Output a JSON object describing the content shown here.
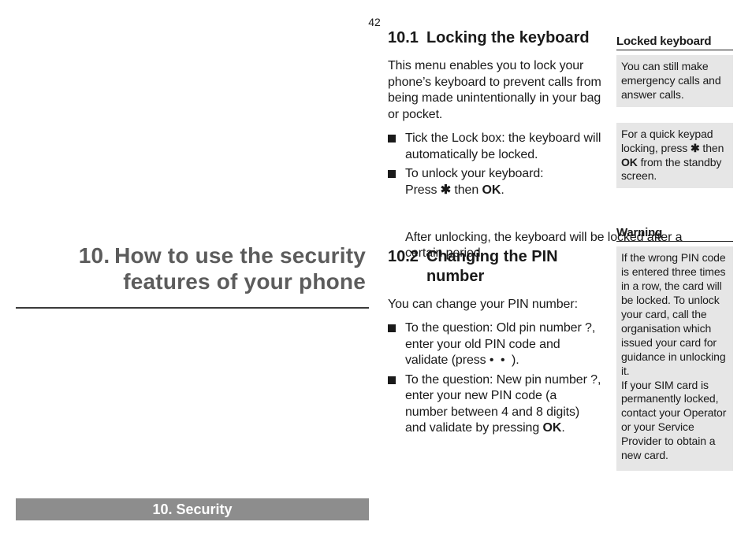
{
  "page_number": "42",
  "chapter": {
    "title_line1": "10. How to use the security",
    "title_line2": "features of your phone",
    "breadcrumb": "10. Security"
  },
  "sections": {
    "s1": {
      "num": "10.1",
      "title": "Locking the keyboard",
      "intro": "This menu enables you to lock your phone’s keyboard to prevent calls from being made unintentionally in your bag or pocket.",
      "items": {
        "i1": "Tick the Lock box: the keyboard will automatically be locked.",
        "i2": {
          "line1": "To unlock your keyboard:",
          "line2_pre": "Press ",
          "star": "✱",
          "line2_mid": " then ",
          "ok": "OK",
          "line2_post": "."
        }
      },
      "tail": "After unlocking, the keyboard will be locked after a certain period."
    },
    "s2": {
      "num": "10.2",
      "title": "Changing the PIN number",
      "intro": "You can change your PIN number:",
      "items": {
        "i1_pre": "To the question: Old pin number ?, enter your old PIN code and validate (press ",
        "i1_dots": " • • ",
        "i1_post": ").",
        "i2_pre": "To the question: New pin number ?, enter your new PIN code (a number between 4 and 8 digits) and validate by pressing ",
        "i2_ok": "OK",
        "i2_post": "."
      }
    }
  },
  "sidebar": {
    "h1": "Locked keyboard",
    "box1": "You can still make emergency calls and answer calls.",
    "box2_pre": "For a quick  keypad locking, press ",
    "box2_star": "✱",
    "box2_mid": " then ",
    "box2_ok": "OK",
    "box2_post": " from the standby screen.",
    "h2": "Warning",
    "box3a": "If the wrong PIN code is entered three times in a row, the card will be locked. To unlock your card, call the organisation which issued your card for guidance in unlocking it.",
    "box3b": "If your SIM card is permanently locked, contact your Operator or your Service Provider to obtain a new card."
  }
}
